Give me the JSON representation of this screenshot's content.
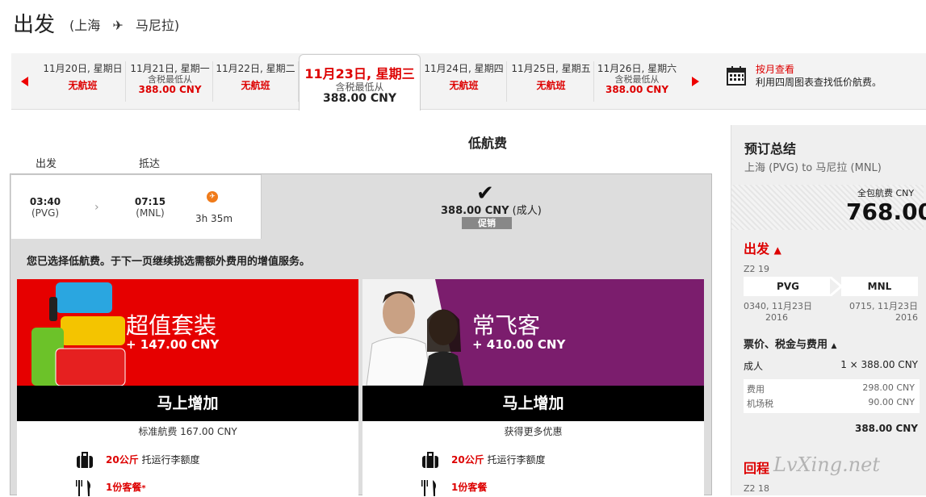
{
  "header": {
    "title": "出发",
    "route_open": "(上海",
    "route_close": "马尼拉)",
    "plane_glyph": "✈"
  },
  "dates": {
    "prev_icon": "left-arrow",
    "next_icon": "right-arrow",
    "days": [
      {
        "date": "11月20日, 星期日",
        "sub": "",
        "price": "",
        "status": "无航班"
      },
      {
        "date": "11月21日, 星期一",
        "sub": "含税最低从",
        "price": "388.00 CNY",
        "status": ""
      },
      {
        "date": "11月22日, 星期二",
        "sub": "",
        "price": "",
        "status": "无航班"
      },
      {
        "date": "11月24日, 星期四",
        "sub": "",
        "price": "",
        "status": "无航班"
      },
      {
        "date": "11月25日, 星期五",
        "sub": "",
        "price": "",
        "status": "无航班"
      },
      {
        "date": "11月26日, 星期六",
        "sub": "含税最低从",
        "price": "388.00 CNY",
        "status": ""
      }
    ],
    "selected": {
      "date": "11月23日, 星期三",
      "sub": "含税最低从",
      "price": "388.00 CNY"
    },
    "calendar": {
      "title": "按月查看",
      "desc": "利用四周图表查找低价航费。"
    }
  },
  "fare": {
    "heading": "低航费",
    "col_depart": "出发",
    "col_arrive": "抵达",
    "depart_time": "03:40",
    "depart_code": "(PVG)",
    "arrive_time": "07:15",
    "arrive_code": "(MNL)",
    "chevron": "›",
    "duration": "3h 35m",
    "checkmark": "✔",
    "price": "388.00 CNY",
    "price_suffix": "(成人)",
    "promo": "促销",
    "selected_msg": "您已选择低航费。于下一页继续挑选需额外费用的增值服务。"
  },
  "bundles": [
    {
      "title": "超值套装",
      "price": "+ 147.00 CNY",
      "button": "马上增加",
      "note": "标准航费 167.00 CNY",
      "f1_bold": "20公斤",
      "f1_text": "托运行李额度",
      "f2_bold": "1份客餐",
      "f2_star": "*"
    },
    {
      "title": "常飞客",
      "price": "+ 410.00 CNY",
      "button": "马上增加",
      "note": "获得更多优惠",
      "f1_bold": "20公斤",
      "f1_text": "托运行李额度",
      "f2_bold": "1份客餐",
      "f2_star": ""
    }
  ],
  "summary": {
    "title": "预订总结",
    "route": "上海 (PVG) to 马尼拉 (MNL)",
    "total_label": "全包航费 CNY",
    "total": "768.00",
    "outbound": "出发",
    "flight_no": "Z2 19",
    "from": "PVG",
    "to": "MNL",
    "dep_dt": "0340, 11月23日",
    "dep_year": "2016",
    "arr_dt": "0715, 11月23日",
    "arr_year": "2016",
    "fees_h": "票价、税金与费用",
    "adult_label": "成人",
    "adult_value": "1 × 388.00 CNY",
    "fee_label": "费用",
    "fee_value": "298.00 CNY",
    "tax_label": "机场税",
    "tax_value": "90.00 CNY",
    "subtotal": "388.00 CNY",
    "return": "回程",
    "return_flight": "Z2 18",
    "watermark": "LvXing.net",
    "accent": "#dd0000"
  }
}
